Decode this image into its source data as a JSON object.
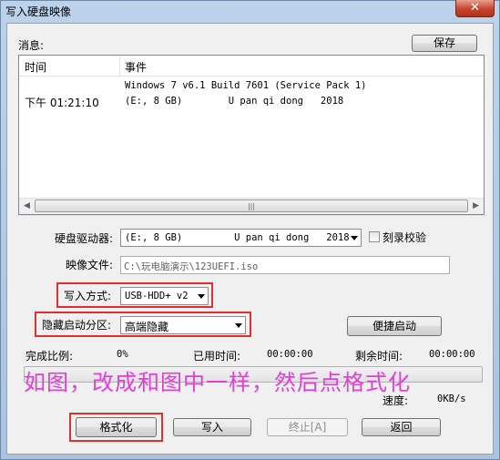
{
  "window": {
    "title": "写入硬盘映像",
    "close_glyph": "✕"
  },
  "messages": {
    "label": "消息:",
    "save_button": "保存",
    "columns": [
      "时间",
      "事件"
    ],
    "rows": [
      {
        "time": "",
        "event": "Windows 7 v6.1 Build 7601 (Service Pack 1)"
      },
      {
        "time": "下午 01:21:10",
        "event": "(E:, 8 GB)        U pan qi dong   2018"
      }
    ]
  },
  "drive": {
    "label": "硬盘驱动器:",
    "value": "(E:, 8 GB)         U pan qi dong   2018",
    "verify_label": "刻录校验",
    "verify_checked": false
  },
  "image_file": {
    "label": "映像文件:",
    "value": "C:\\玩电脑演示\\123UEFI.iso"
  },
  "write_mode": {
    "label": "写入方式:",
    "value": "USB-HDD+ v2"
  },
  "hidden_partition": {
    "label": "隐藏启动分区:",
    "value": "高端隐藏",
    "quick_boot_button": "便捷启动"
  },
  "progress": {
    "done_label": "完成比例:",
    "done_value": "0%",
    "elapsed_label": "已用时间:",
    "elapsed_value": "00:00:00",
    "remaining_label": "剩余时间:",
    "remaining_value": "00:00:00",
    "fraction": 0,
    "speed_label": "速度:",
    "speed_value": "0KB/s"
  },
  "annotation": "如图，改成和图中一样，然后点格式化",
  "buttons": {
    "format": "格式化",
    "write": "写入",
    "abort": "终止[A]",
    "back": "返回"
  },
  "colors": {
    "highlight_box": "#e03030",
    "annotation_text": "#e040d8"
  }
}
